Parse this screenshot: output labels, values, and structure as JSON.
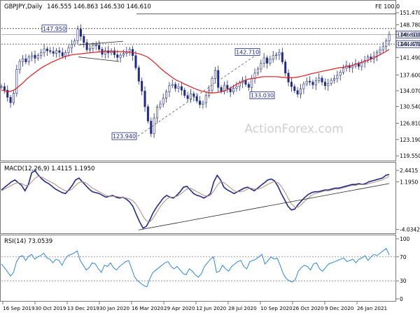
{
  "colors": {
    "candle": "#1f2a8a",
    "ma": "#e11d1d",
    "rsi": "#2f86e6",
    "macd_line": "#1f2a8a",
    "signal_line": "#b08b80",
    "grid": "#c8c8c8",
    "watermark": "#cfcfcf"
  },
  "watermark": "ActionForex.com",
  "chart_data": [
    {
      "type": "candlestick",
      "title": "GBPJPY,Daily",
      "ohlc_label": "146.555 146.863 146.530 146.610",
      "ylim": [
        118.8,
        151.5
      ],
      "y_ticks": [
        "151.470",
        "148.780",
        "146.610",
        "144.470",
        "141.490",
        "137.600",
        "134.070",
        "130.540",
        "126.810",
        "123.190",
        "119.550"
      ],
      "fe_label": "FE 100.0",
      "fe_level": 151.2,
      "hlines": [
        147.95,
        144.47
      ],
      "annotations": [
        {
          "text": "147.950",
          "value": 147.95
        },
        {
          "text": "144.470",
          "value": 144.47
        },
        {
          "text": "146.610",
          "value": 146.61
        },
        {
          "text": "142.710",
          "value": 142.71
        },
        {
          "text": "133.030",
          "value": 133.03
        },
        {
          "text": "123.940",
          "value": 123.94
        }
      ],
      "close_series": [
        135.0,
        134.2,
        132.6,
        131.4,
        133.5,
        138.8,
        140.6,
        141.2,
        140.5,
        141.6,
        142.0,
        141.3,
        141.9,
        142.6,
        143.4,
        143.0,
        142.8,
        142.4,
        143.0,
        142.6,
        141.8,
        142.6,
        143.6,
        144.4,
        145.2,
        147.8,
        146.2,
        144.8,
        143.2,
        143.5,
        144.3,
        144.2,
        143.3,
        142.2,
        143.0,
        142.5,
        143.0,
        142.1,
        141.5,
        142.0,
        142.4,
        142.8,
        143.3,
        141.9,
        139.2,
        136.2,
        134.0,
        130.5,
        127.3,
        124.5,
        128.0,
        130.4,
        131.1,
        132.4,
        133.8,
        135.2,
        135.5,
        134.6,
        135.0,
        134.2,
        133.0,
        132.3,
        133.4,
        132.8,
        131.8,
        131.0,
        131.4,
        133.0,
        134.2,
        136.8,
        138.6,
        134.8,
        134.0,
        135.3,
        134.5,
        133.8,
        134.6,
        135.0,
        135.8,
        136.4,
        135.5,
        134.8,
        136.8,
        138.0,
        138.9,
        140.2,
        141.4,
        140.2,
        141.1,
        141.9,
        142.1,
        142.6,
        140.5,
        138.0,
        136.0,
        135.0,
        134.1,
        133.3,
        134.5,
        135.6,
        136.2,
        136.0,
        135.4,
        136.3,
        136.9,
        136.0,
        135.2,
        135.7,
        136.4,
        136.8,
        137.5,
        138.2,
        139.1,
        139.7,
        139.2,
        139.6,
        140.1,
        139.5,
        140.3,
        140.8,
        141.6,
        141.1,
        141.8,
        142.6,
        143.2,
        143.9,
        145.2,
        146.6
      ],
      "ma_series": [
        134.2,
        134.0,
        133.9,
        134.2,
        134.9,
        135.7,
        136.6,
        137.4,
        138.1,
        138.8,
        139.4,
        139.9,
        140.4,
        140.8,
        141.2,
        141.6,
        141.9,
        142.1,
        142.2,
        142.3,
        142.4,
        142.5,
        142.6,
        142.7,
        142.8,
        142.8,
        142.8,
        142.8,
        142.8,
        142.8,
        142.7,
        142.6,
        142.5,
        142.3,
        142.0,
        141.6,
        140.9,
        140.1,
        139.2,
        138.4,
        137.7,
        137.0,
        136.4,
        136.0,
        135.5,
        135.1,
        134.7,
        134.3,
        134.0,
        133.8,
        133.6,
        133.6,
        133.7,
        133.9,
        134.2,
        134.7,
        135.3,
        135.8,
        136.2,
        136.6,
        136.8,
        136.9,
        137.1,
        137.2,
        137.2,
        137.2,
        137.2,
        137.1,
        137.0,
        137.0,
        137.0,
        137.1,
        137.3,
        137.5,
        137.8,
        138.0,
        138.2,
        138.4,
        138.6,
        138.8,
        139.0,
        139.2,
        139.3,
        139.5,
        139.7,
        140.0,
        140.3,
        140.6,
        140.9,
        141.3,
        141.7,
        142.2,
        142.7,
        143.3
      ]
    },
    {
      "type": "line",
      "title": "MACD(12,26,9) 1.4115 1.1950",
      "ylim": [
        -4.3,
        2.6
      ],
      "y_ticks": [
        "2.4415",
        "1.1950",
        "-4.0342"
      ],
      "series": [
        {
          "name": "MACD",
          "values": [
            0.3,
            0.6,
            0.9,
            1.2,
            1.4,
            1.1,
            0.8,
            0.2,
            0.9,
            2.2,
            2.4,
            1.9,
            1.5,
            1.2,
            1.0,
            0.7,
            0.4,
            0.2,
            0.0,
            -0.1,
            0.3,
            0.8,
            1.4,
            1.6,
            1.2,
            0.8,
            0.4,
            0.1,
            0.0,
            -0.1,
            -0.3,
            -0.5,
            -0.4,
            -0.3,
            -0.5,
            -0.6,
            -0.5,
            -0.7,
            -1.0,
            -1.5,
            -2.4,
            -3.2,
            -3.9,
            -3.7,
            -3.0,
            -2.2,
            -1.6,
            -1.1,
            -0.6,
            -0.3,
            -0.5,
            -0.6,
            -0.3,
            0.1,
            0.6,
            0.7,
            0.3,
            -0.1,
            -0.3,
            -0.4,
            -0.6,
            -0.4,
            -0.1,
            1.2,
            1.9,
            1.4,
            0.6,
            0.3,
            0.1,
            -0.1,
            0.1,
            0.3,
            0.5,
            0.6,
            0.4,
            0.2,
            0.5,
            0.8,
            1.1,
            1.4,
            1.5,
            1.3,
            0.7,
            -0.1,
            -0.8,
            -1.5,
            -1.9,
            -1.8,
            -1.3,
            -0.9,
            -0.5,
            -0.2,
            0.0,
            0.1,
            0.1,
            0.2,
            0.3,
            0.3,
            0.4,
            0.5,
            0.5,
            0.6,
            0.7,
            0.8,
            0.9,
            0.9,
            1.0,
            0.9,
            1.0,
            1.2,
            1.3,
            1.4,
            1.5,
            1.6,
            1.9,
            2.0
          ]
        },
        {
          "name": "Signal",
          "values": [
            0.2,
            0.4,
            0.6,
            0.8,
            1.0,
            1.1,
            1.0,
            0.8,
            0.8,
            1.2,
            1.6,
            1.8,
            1.7,
            1.5,
            1.3,
            1.1,
            0.9,
            0.6,
            0.4,
            0.2,
            0.2,
            0.4,
            0.8,
            1.1,
            1.2,
            1.1,
            0.8,
            0.5,
            0.3,
            0.1,
            -0.1,
            -0.3,
            -0.4,
            -0.4,
            -0.4,
            -0.5,
            -0.5,
            -0.6,
            -0.7,
            -0.9,
            -1.3,
            -1.9,
            -2.6,
            -3.1,
            -3.2,
            -2.8,
            -2.2,
            -1.6,
            -1.1,
            -0.7,
            -0.5,
            -0.5,
            -0.4,
            -0.2,
            0.1,
            0.4,
            0.5,
            0.3,
            0.1,
            -0.1,
            -0.3,
            -0.4,
            -0.3,
            0.2,
            0.8,
            1.2,
            1.1,
            0.8,
            0.5,
            0.2,
            0.1,
            0.1,
            0.2,
            0.4,
            0.5,
            0.4,
            0.4,
            0.5,
            0.7,
            0.9,
            1.1,
            1.2,
            1.1,
            0.7,
            0.1,
            -0.6,
            -1.2,
            -1.6,
            -1.6,
            -1.3,
            -0.9,
            -0.6,
            -0.3,
            -0.1,
            0.0,
            0.1,
            0.2,
            0.2,
            0.3,
            0.4,
            0.4,
            0.5,
            0.6,
            0.7,
            0.8,
            0.8,
            0.9,
            0.9,
            0.9,
            1.0,
            1.1,
            1.2,
            1.3,
            1.4,
            1.6,
            1.8
          ]
        }
      ],
      "trendline": [
        [
          -4.1,
          0
        ],
        [
          1.0,
          1
        ]
      ]
    },
    {
      "type": "line",
      "title": "RSI(14) 73.0539",
      "ylim": [
        0,
        100
      ],
      "y_ticks": [
        "100",
        "70",
        "30",
        "0"
      ],
      "levels": [
        70,
        30
      ],
      "series": [
        {
          "name": "RSI",
          "values": [
            58,
            52,
            45,
            38,
            44,
            62,
            70,
            72,
            64,
            71,
            74,
            66,
            70,
            72,
            76,
            68,
            66,
            60,
            66,
            64,
            56,
            66,
            72,
            74,
            76,
            80,
            64,
            56,
            48,
            52,
            60,
            58,
            50,
            44,
            56,
            54,
            60,
            52,
            48,
            54,
            58,
            62,
            64,
            50,
            36,
            30,
            26,
            22,
            20,
            34,
            44,
            48,
            52,
            56,
            60,
            62,
            54,
            50,
            54,
            48,
            42,
            40,
            50,
            46,
            40,
            36,
            42,
            54,
            60,
            66,
            70,
            44,
            46,
            56,
            50,
            46,
            54,
            58,
            62,
            64,
            54,
            50,
            62,
            64,
            66,
            70,
            74,
            58,
            64,
            70,
            66,
            68,
            56,
            42,
            34,
            30,
            28,
            32,
            46,
            52,
            56,
            54,
            48,
            58,
            60,
            50,
            46,
            52,
            58,
            60,
            62,
            64,
            66,
            68,
            62,
            64,
            66,
            60,
            66,
            68,
            72,
            64,
            70,
            74,
            72,
            76,
            80,
            84,
            73
          ]
        }
      ]
    }
  ],
  "x_labels": [
    "16 Sep 2019",
    "30 Oct 2019",
    "13 Dec 2019",
    "30 Jan 2020",
    "16 Mar 2020",
    "29 Apr 2020",
    "12 Jun 2020",
    "28 Jul 2020",
    "10 Sep 2020",
    "26 Oct 2020",
    "9 Dec 2020",
    "26 Jan 2021"
  ]
}
